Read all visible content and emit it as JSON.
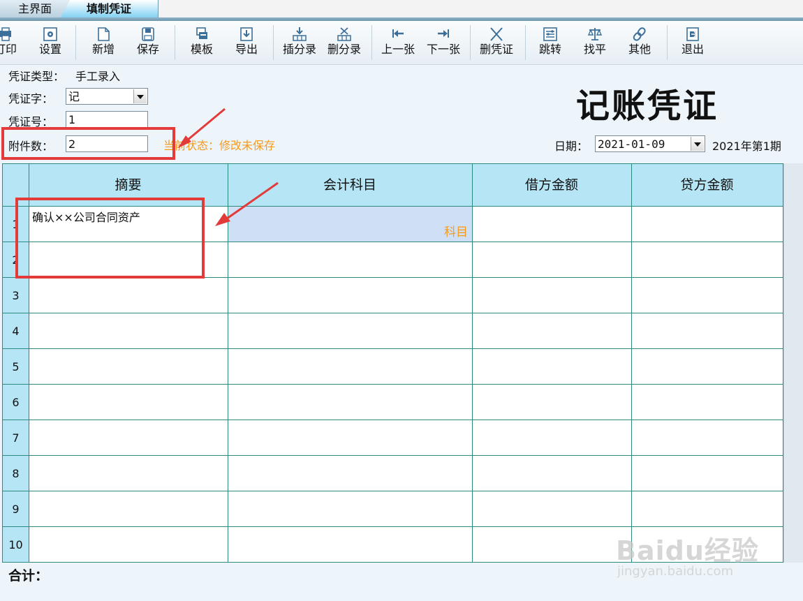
{
  "tabs": [
    {
      "label": "主界面",
      "active": false
    },
    {
      "label": "填制凭证",
      "active": true
    }
  ],
  "toolbar": [
    {
      "label": "打印",
      "icon": "print-icon"
    },
    {
      "label": "设置",
      "icon": "settings-icon"
    },
    {
      "label": "新增",
      "icon": "new-document-icon"
    },
    {
      "label": "保存",
      "icon": "save-icon"
    },
    {
      "label": "模板",
      "icon": "template-icon"
    },
    {
      "label": "导出",
      "icon": "export-icon"
    },
    {
      "label": "插分录",
      "icon": "insert-entry-icon"
    },
    {
      "label": "删分录",
      "icon": "delete-entry-icon"
    },
    {
      "label": "上一张",
      "icon": "previous-icon"
    },
    {
      "label": "下一张",
      "icon": "next-icon"
    },
    {
      "label": "删凭证",
      "icon": "delete-voucher-icon"
    },
    {
      "label": "跳转",
      "icon": "jump-icon"
    },
    {
      "label": "找平",
      "icon": "balance-icon"
    },
    {
      "label": "其他",
      "icon": "link-icon"
    },
    {
      "label": "退出",
      "icon": "exit-icon"
    }
  ],
  "header": {
    "voucher_type_label": "凭证类型：",
    "voucher_type_value": "手工录入",
    "voucher_word_label": "凭证字：",
    "voucher_word_value": "记",
    "voucher_no_label": "凭证号：",
    "voucher_no_value": "1",
    "attachments_label": "附件数：",
    "attachments_value": "2",
    "status_text": "当前状态：修改未保存",
    "title": "记账凭证",
    "date_label": "日期：",
    "date_value": "2021-01-09",
    "period_text": "2021年第1期"
  },
  "grid": {
    "columns": [
      "摘要",
      "会计科目",
      "借方金额",
      "贷方金额"
    ],
    "row_numbers": [
      "1",
      "2",
      "3",
      "4",
      "5",
      "6",
      "7",
      "8",
      "9",
      "10"
    ],
    "rows": [
      {
        "summary": "确认××公司合同资产",
        "subject": "",
        "debit": "",
        "credit": ""
      }
    ],
    "subject_hint": "科目",
    "total_label": "合计："
  },
  "watermark": {
    "main": "Baidu经验",
    "sub": "jingyan.baidu.com"
  },
  "colors": {
    "accent_header": "#b6e6f5",
    "grid_line": "#2b8a7e",
    "status_orange": "#f59a1d",
    "annotation_red": "#e33a3a"
  }
}
